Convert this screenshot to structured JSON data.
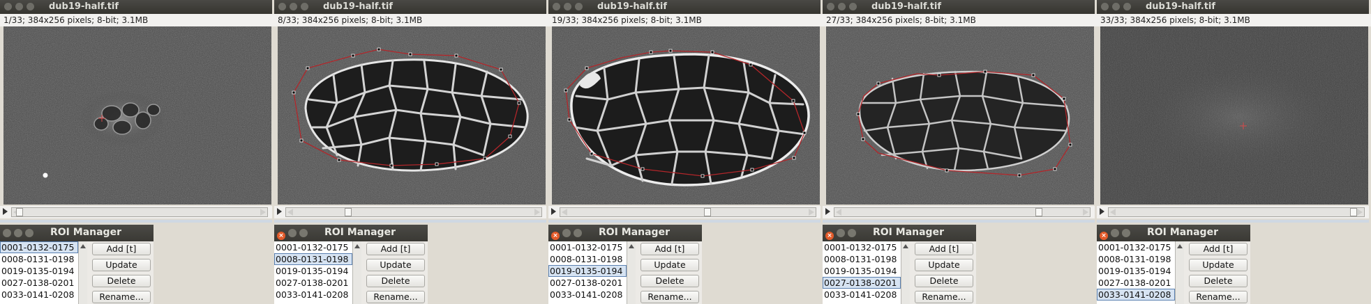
{
  "panels": [
    {
      "title": "dub19-half.tif",
      "info": "1/33; 384x256 pixels; 8-bit; 3.1MB",
      "thumb": 0.0,
      "roi": {
        "title": "ROI Manager",
        "items": [
          "0001-0132-0175",
          "0008-0131-0198",
          "0019-0135-0194",
          "0027-0138-0201",
          "0033-0141-0208"
        ],
        "selected": 0,
        "buttons": {
          "add": "Add [t]",
          "update": "Update",
          "delete": "Delete",
          "rename": "Rename..."
        }
      }
    },
    {
      "title": "dub19-half.tif",
      "info": "8/33; 384x256 pixels; 8-bit; 3.1MB",
      "thumb": 0.22,
      "roi": {
        "title": "ROI Manager",
        "items": [
          "0001-0132-0175",
          "0008-0131-0198",
          "0019-0135-0194",
          "0027-0138-0201",
          "0033-0141-0208"
        ],
        "selected": 1,
        "buttons": {
          "add": "Add [t]",
          "update": "Update",
          "delete": "Delete",
          "rename": "Rename..."
        }
      }
    },
    {
      "title": "dub19-half.tif",
      "info": "19/33; 384x256 pixels; 8-bit; 3.1MB",
      "thumb": 0.56,
      "roi": {
        "title": "ROI Manager",
        "items": [
          "0001-0132-0175",
          "0008-0131-0198",
          "0019-0135-0194",
          "0027-0138-0201",
          "0033-0141-0208"
        ],
        "selected": 2,
        "buttons": {
          "add": "Add [t]",
          "update": "Update",
          "delete": "Delete",
          "rename": "Rename..."
        }
      }
    },
    {
      "title": "dub19-half.tif",
      "info": "27/33; 384x256 pixels; 8-bit; 3.1MB",
      "thumb": 0.81,
      "roi": {
        "title": "ROI Manager",
        "items": [
          "0001-0132-0175",
          "0008-0131-0198",
          "0019-0135-0194",
          "0027-0138-0201",
          "0033-0141-0208"
        ],
        "selected": 3,
        "buttons": {
          "add": "Add [t]",
          "update": "Update",
          "delete": "Delete",
          "rename": "Rename..."
        }
      }
    },
    {
      "title": "dub19-half.tif",
      "info": "33/33; 384x256 pixels; 8-bit; 3.1MB",
      "thumb": 1.0,
      "roi": {
        "title": "ROI Manager",
        "items": [
          "0001-0132-0175",
          "0008-0131-0198",
          "0019-0135-0194",
          "0027-0138-0201",
          "0033-0141-0208"
        ],
        "selected": 4,
        "buttons": {
          "add": "Add [t]",
          "update": "Update",
          "delete": "Delete",
          "rename": "Rename..."
        }
      }
    }
  ],
  "colors": {
    "roi_outline": "#b3262a",
    "selection": "#d6e3f2",
    "titlebar": "#3c3b37"
  },
  "icons": {
    "close": "close-icon",
    "minimize": "minimize-icon",
    "maximize": "maximize-icon",
    "play": "play-icon"
  }
}
